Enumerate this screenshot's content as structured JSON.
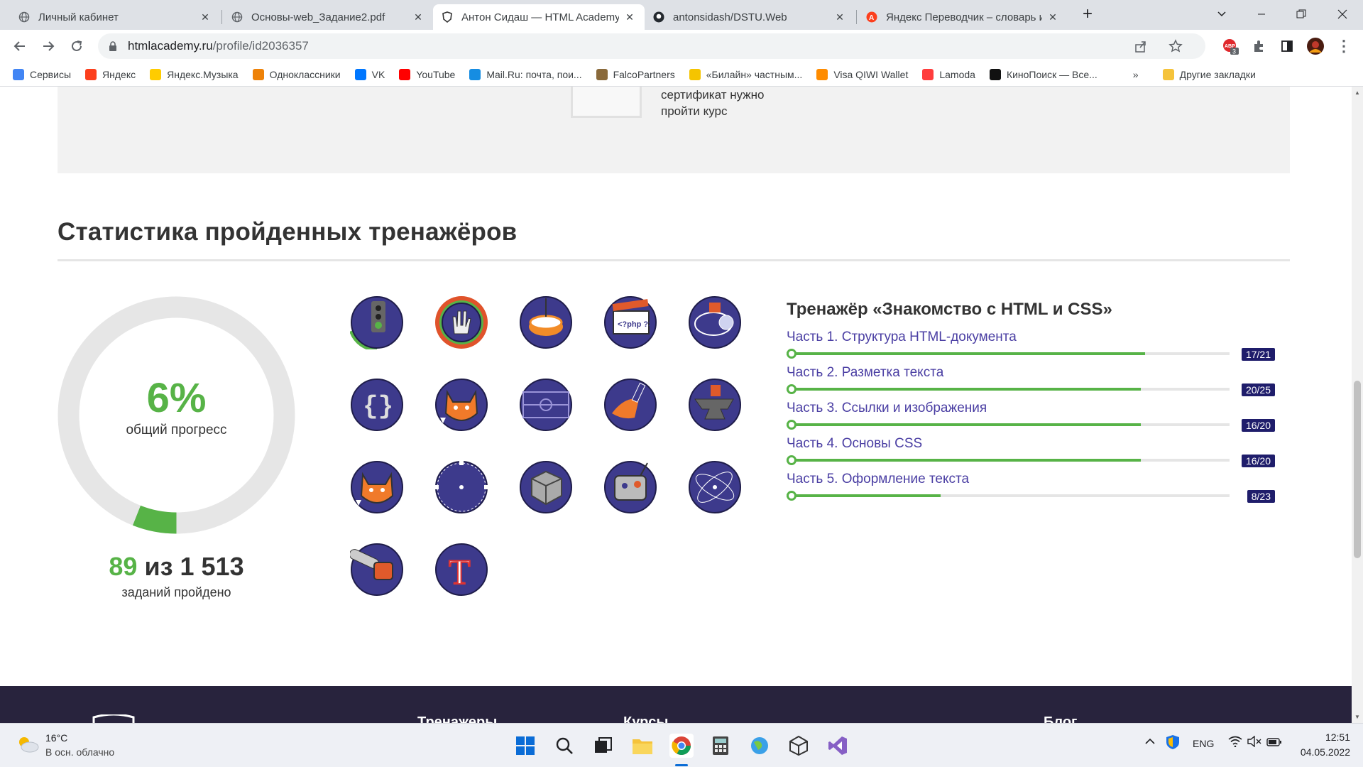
{
  "browser": {
    "tabs": [
      {
        "title": "Личный кабинет"
      },
      {
        "title": "Основы-web_Задание2.pdf"
      },
      {
        "title": "Антон Сидаш — HTML Academy"
      },
      {
        "title": "antonsidash/DSTU.Web"
      },
      {
        "title": "Яндекс Переводчик – словарь и"
      }
    ],
    "url_host": "htmlacademy.ru",
    "url_path": "/profile/id2036357",
    "extension_badge": "3",
    "bookmarks": [
      {
        "label": "Сервисы",
        "color": "#4285f4"
      },
      {
        "label": "Яндекс",
        "color": "#fc3f1d"
      },
      {
        "label": "Яндекс.Музыка",
        "color": "#ffcc00"
      },
      {
        "label": "Одноклассники",
        "color": "#ee8208"
      },
      {
        "label": "VK",
        "color": "#0077ff"
      },
      {
        "label": "YouTube",
        "color": "#ff0000"
      },
      {
        "label": "Mail.Ru: почта, пои...",
        "color": "#168de2"
      },
      {
        "label": "FalcoPartners",
        "color": "#8a6a3b"
      },
      {
        "label": "«Билайн» частным...",
        "color": "#f5c400"
      },
      {
        "label": "Visa QIWI Wallet",
        "color": "#ff8c00"
      },
      {
        "label": "Lamoda",
        "color": "#ff3d3d"
      },
      {
        "label": "КиноПоиск — Все...",
        "color": "#111111"
      }
    ],
    "bookmarks_more": "»",
    "other_bookmarks": "Другие закладки"
  },
  "page": {
    "certificate_text": "сертификат нужно пройти курс",
    "section_title": "Статистика пройденных тренажёров",
    "progress_percent_label": "6%",
    "progress_value": 0.06,
    "progress_caption": "общий прогресс",
    "done_count": "89",
    "done_of": "из 1 513",
    "done_caption": "заданий пройдено",
    "badges": [
      "traffic-light",
      "vulcan-hand",
      "spinning-top",
      "php-clapperboard",
      "submarine",
      "curly-braces",
      "fox-wine",
      "football-field",
      "paint-brush",
      "anvil",
      "fox-cat",
      "vector-circle",
      "rubiks-cube",
      "robot",
      "orbit",
      "chainsaw",
      "letter-t"
    ],
    "trainer_title": "Тренажёр «Знакомство с HTML и CSS»",
    "parts": [
      {
        "label": "Часть 1. Структура HTML-документа",
        "done": 17,
        "total": 21,
        "progress_label": "17/21"
      },
      {
        "label": "Часть 2. Разметка текста",
        "done": 20,
        "total": 25,
        "progress_label": "20/25"
      },
      {
        "label": "Часть 3. Ссылки и изображения",
        "done": 16,
        "total": 20,
        "progress_label": "16/20"
      },
      {
        "label": "Часть 4. Основы CSS",
        "done": 16,
        "total": 20,
        "progress_label": "16/20"
      },
      {
        "label": "Часть 5. Оформление текста",
        "done": 8,
        "total": 23,
        "progress_label": "8/23"
      }
    ],
    "footer_headings": [
      "Тренажеры",
      "Курсы",
      "Блог"
    ]
  },
  "taskbar": {
    "weather_temp": "16°C",
    "weather_desc": "В осн. облачно",
    "lang": "ENG",
    "time": "12:51",
    "date": "04.05.2022"
  },
  "colors": {
    "accent_green": "#57b347",
    "badge_navy": "#3d3a8c",
    "link_purple": "#4a3ea3"
  }
}
